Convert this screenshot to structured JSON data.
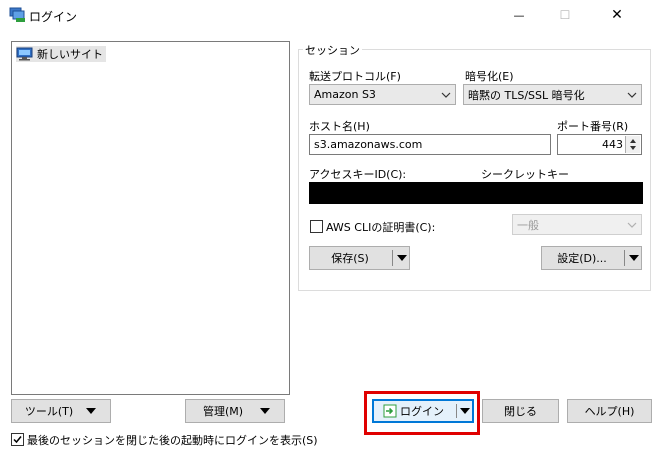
{
  "window": {
    "title": "ログイン",
    "min_glyph": "—",
    "max_glyph": "☐",
    "close_glyph": "✕"
  },
  "site_tree": {
    "items": [
      {
        "label": "新しいサイト",
        "icon": "computer-site-icon"
      }
    ]
  },
  "session": {
    "legend": "セッション",
    "protocol_label": "転送プロトコル(F)",
    "protocol_value": "Amazon S3",
    "encryption_label": "暗号化(E)",
    "encryption_value": "暗黙の TLS/SSL 暗号化",
    "host_label": "ホスト名(H)",
    "host_value": "s3.amazonaws.com",
    "port_label": "ポート番号(R)",
    "port_value": "443",
    "access_key_label": "アクセスキーID(C):",
    "secret_key_label": "シークレットキー",
    "awscli_label": "AWS CLIの証明書(C):",
    "awscli_checked": false,
    "profile_value": "一般",
    "save_label": "保存(S)",
    "settings_label": "設定(D)..."
  },
  "bottom": {
    "tools_label": "ツール(T)",
    "manage_label": "管理(M)",
    "login_label": "ログイン",
    "close_label": "閉じる",
    "help_label": "ヘルプ(H)",
    "startup_label": "最後のセッションを閉じた後の起動時にログインを表示(S)",
    "startup_checked": true
  },
  "colors": {
    "highlight": "#e00000",
    "focus_border": "#0078d7",
    "secret_fill": "#000000"
  }
}
